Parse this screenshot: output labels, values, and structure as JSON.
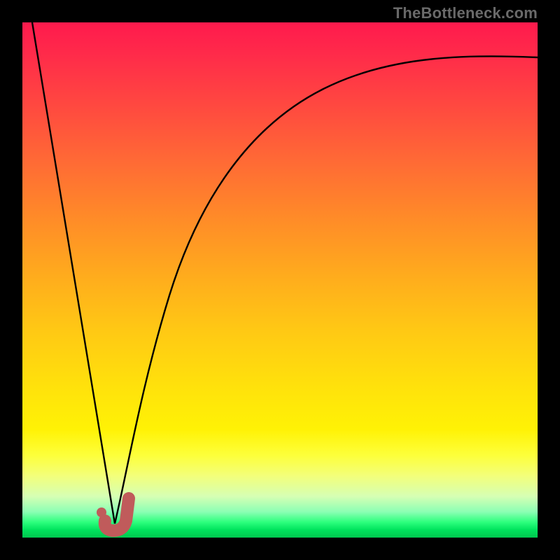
{
  "watermark": "TheBottleneck.com",
  "colors": {
    "marker": "#c05b5b",
    "curve": "#000000",
    "frame": "#000000"
  },
  "chart_data": {
    "type": "line",
    "title": "",
    "xlabel": "",
    "ylabel": "",
    "xlim": [
      0,
      100
    ],
    "ylim": [
      0,
      100
    ],
    "grid": false,
    "series": [
      {
        "name": "left-descent",
        "x": [
          0,
          17
        ],
        "y": [
          100,
          2
        ]
      },
      {
        "name": "right-curve",
        "x": [
          17,
          20,
          24,
          30,
          38,
          48,
          60,
          74,
          88,
          100
        ],
        "y": [
          2,
          10,
          25,
          45,
          62,
          75,
          84,
          89,
          92,
          93
        ]
      }
    ],
    "markers": [
      {
        "name": "optimal-point",
        "x": 15.5,
        "y": 3.5
      }
    ],
    "annotations": [
      {
        "name": "j-hook-region",
        "x_range": [
          15,
          20
        ],
        "y_range": [
          0,
          7
        ]
      }
    ]
  }
}
